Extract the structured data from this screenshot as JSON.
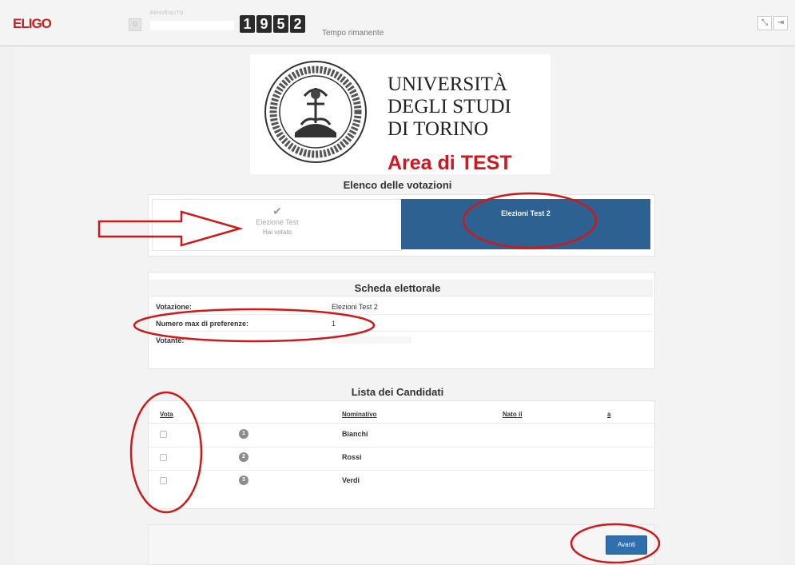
{
  "app": {
    "logo": "ELIGO"
  },
  "topbar": {
    "welcome_label": "BENVENUTO:",
    "timer_digits": [
      "1",
      "9",
      "5",
      "2"
    ],
    "timer_label": "Tempo rimanente",
    "fullscreen_icon": "expand-icon",
    "logout_icon": "logout-icon"
  },
  "header": {
    "university_lines": [
      "UNIVERSITÀ",
      "DEGLI STUDI",
      "DI TORINO"
    ],
    "area_label": "Area di TEST",
    "seal_text": "TAURINORUM SIGIL UNIVERSITATIS AUGUSTAE"
  },
  "elections": {
    "title": "Elenco delle votazioni",
    "items": [
      {
        "name": "Elezione Test",
        "status": "Hai votato",
        "icon": "check-icon"
      },
      {
        "name": "Elezioni Test 2"
      }
    ]
  },
  "ballot": {
    "title": "Scheda elettorale",
    "rows": [
      {
        "label": "Votazione:",
        "value": "Elezioni Test 2"
      },
      {
        "label": "Numero max di preferenze:",
        "value": "1"
      },
      {
        "label": "Votante:",
        "value": ""
      }
    ]
  },
  "candidates": {
    "title": "Lista dei Candidati",
    "headers": {
      "vote": "Vota",
      "name": "Nominativo",
      "born": "Nato il",
      "at": "a"
    },
    "rows": [
      {
        "number": "1",
        "name": "Bianchi"
      },
      {
        "number": "2",
        "name": "Rossi"
      },
      {
        "number": "3",
        "name": "Verdi"
      }
    ]
  },
  "actions": {
    "next_label": "Avanti"
  },
  "colors": {
    "brand": "#c8201c",
    "selected_election": "#2d6191",
    "annotation": "#d01818",
    "button": "#2f6fad"
  }
}
